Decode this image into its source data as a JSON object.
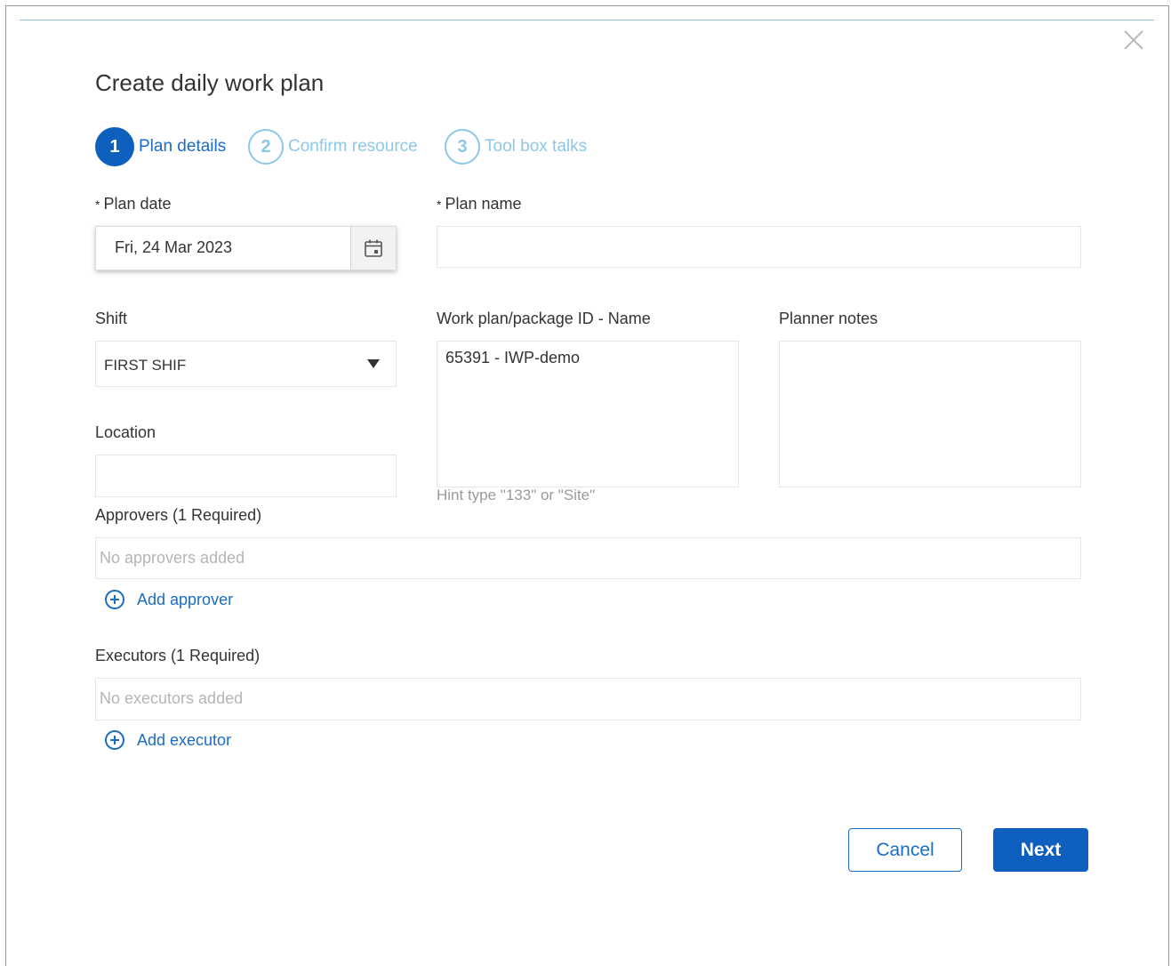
{
  "dialog": {
    "title": "Create daily work plan",
    "close_icon": "close-icon"
  },
  "steps": [
    {
      "number": "1",
      "label": "Plan details",
      "state": "active"
    },
    {
      "number": "2",
      "label": "Confirm resource",
      "state": "inactive"
    },
    {
      "number": "3",
      "label": "Tool box talks",
      "state": "inactive"
    }
  ],
  "form": {
    "required_marker": "*",
    "plan_date": {
      "label": "Plan date",
      "value": "Fri, 24 Mar 2023",
      "icon": "calendar-icon"
    },
    "plan_name": {
      "label": "Plan name",
      "value": ""
    },
    "shift": {
      "label": "Shift",
      "value": "FIRST SHIF",
      "icon": "caret-down-icon"
    },
    "work_plan": {
      "label": "Work plan/package ID - Name",
      "value": "65391 - IWP-demo",
      "hint": "Hint type \"133\" or \"Site\""
    },
    "planner_notes": {
      "label": "Planner notes",
      "value": ""
    },
    "location": {
      "label": "Location",
      "value": ""
    },
    "approvers": {
      "label": "Approvers (1 Required)",
      "placeholder": "No approvers added",
      "add_label": "Add approver"
    },
    "executors": {
      "label": "Executors (1 Required)",
      "placeholder": "No executors added",
      "add_label": "Add executor"
    }
  },
  "footer": {
    "cancel_label": "Cancel",
    "next_label": "Next"
  },
  "colors": {
    "primary": "#0f5fbf",
    "link": "#1a6cc4",
    "step_inactive": "#8dc8e8"
  }
}
